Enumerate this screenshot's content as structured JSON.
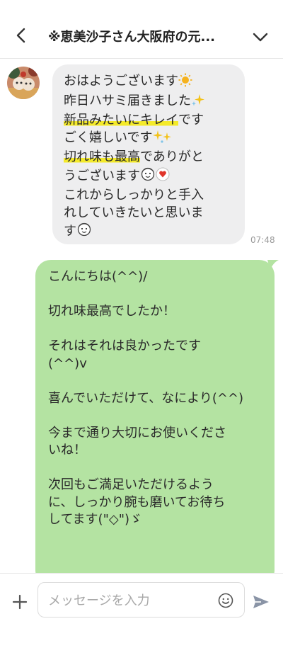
{
  "header": {
    "title": "※恵美沙子さん大阪府の元...",
    "back_icon": "chevron-left-icon",
    "menu_icon": "chevron-down-icon"
  },
  "incoming": {
    "lines": [
      {
        "text": "おはようございます",
        "suffix": "sun-emoji"
      },
      {
        "text": "昨日ハサミ届きました",
        "suffix": "sparkles-emoji"
      },
      {
        "highlight": "新品みたいにキレイ",
        "text": "です"
      },
      {
        "text": "ごく嬉しいです",
        "suffix": "sparkles-emoji"
      },
      {
        "highlight": "切れ味も最高",
        "text": "でありがと"
      },
      {
        "text": "うございます",
        "suffix": "face-heart-emoji"
      },
      {
        "text": "これからしっかりと手入"
      },
      {
        "text": "れしていきたいと思いま"
      },
      {
        "text": "す",
        "suffix": "face-emoji"
      }
    ],
    "time": "07:48",
    "highlight_color": "#f4ea2a",
    "bubble_color": "#eeeeef"
  },
  "outgoing": {
    "lines": [
      "こんにちは(^^)/",
      "",
      "切れ味最高でしたか！",
      "",
      "それはそれは良かったです",
      "(^^)v",
      "",
      "喜んでいただけて、なにより(^^)",
      "",
      "今まで通り大切にお使いくださ",
      "いね！",
      "",
      "次回もご満足いただけるよう",
      "に、しっかり腕も磨いてお待ち",
      "してます(\"◇\")ゞ"
    ],
    "bubble_color": "#b4e3a2"
  },
  "input_bar": {
    "placeholder": "メッセージを入力",
    "value": "",
    "plus_icon": "plus-icon",
    "emoji_icon": "smiley-icon",
    "send_icon": "send-icon"
  }
}
